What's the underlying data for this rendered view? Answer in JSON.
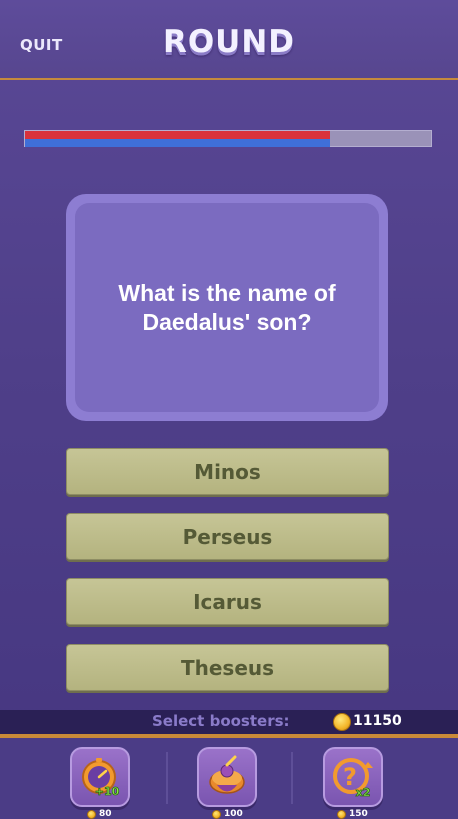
{
  "header": {
    "quit_label": "QUIT",
    "title": "ROUND"
  },
  "progress": {
    "red_fraction": 0.75,
    "blue_fraction": 0.75
  },
  "question": {
    "text": "What is the name of Daedalus' son?"
  },
  "answers": [
    {
      "label": "Minos"
    },
    {
      "label": "Perseus"
    },
    {
      "label": "Icarus"
    },
    {
      "label": "Theseus"
    }
  ],
  "boosters_bar": {
    "label": "Select boosters:",
    "coins": "11150"
  },
  "boosters": [
    {
      "icon": "stopwatch-plus10-icon",
      "badge": "+10",
      "price": "80"
    },
    {
      "icon": "spinning-top-icon",
      "price": "100"
    },
    {
      "icon": "question-x2-icon",
      "badge": "x2",
      "price": "150"
    }
  ],
  "colors": {
    "background": "#4f3f89",
    "accent_orange": "#c98a38",
    "answer_button": "#bfbe8c",
    "progress_red": "#d9323c",
    "progress_blue": "#3f6fd8"
  }
}
